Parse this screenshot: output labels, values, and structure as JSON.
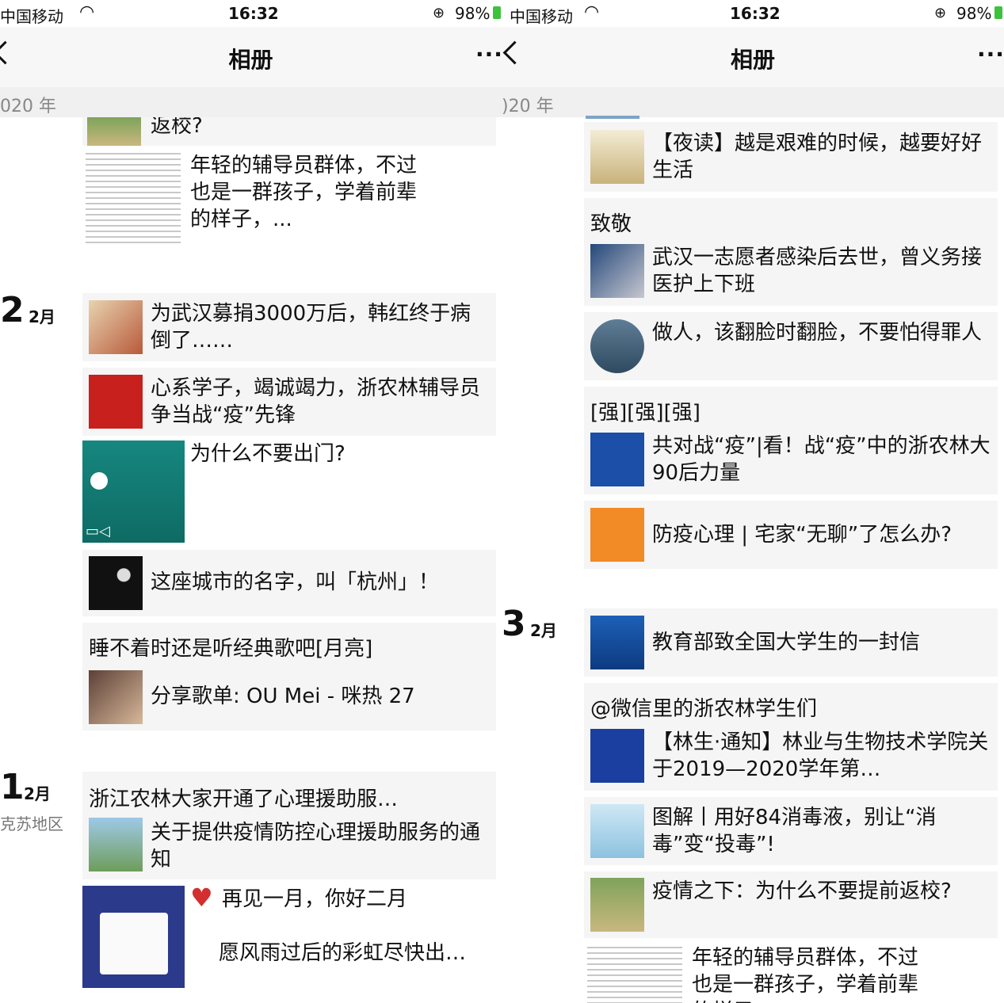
{
  "status": {
    "carrier": "中国移动",
    "time": "16:32",
    "battery": "98%"
  },
  "nav": {
    "title": "相册",
    "more": "···"
  },
  "left": {
    "year_partial": "020 年",
    "group1": {
      "title_tail": "返校?",
      "excerpt": "年轻的辅导员群体，不过也是一群孩子，学着前辈的样子，..."
    },
    "group2": {
      "day": "2",
      "month": "2月",
      "items": [
        "为武汉募捐3000万后，韩红终于病倒了……",
        "心系学子，竭诚竭力，浙农林辅导员争当战“疫”先锋",
        "为什么不要出门?",
        "这座城市的名字，叫「杭州」！"
      ],
      "music_header": "睡不着时还是听经典歌吧[月亮]",
      "music_item": "分享歌单: OU Mei - 咪热 27"
    },
    "group3": {
      "day": "1",
      "month": "2月",
      "location": "克苏地区",
      "header": "浙江农林大家开通了心理援助服…",
      "item": "关于提供疫情防控心理援助服务的通知",
      "post_line1": "再见一月，你好二月",
      "post_line2": "愿风雨过后的彩虹尽快出…"
    }
  },
  "right": {
    "year_partial": ")20 年",
    "items": [
      {
        "title": "【夜读】越是艰难的时候，越要好好生活"
      },
      {
        "header": "致敬",
        "title": "武汉一志愿者感染后去世，曾义务接医护上下班"
      },
      {
        "title": "做人，该翻脸时翻脸，不要怕得罪人"
      },
      {
        "header": "[强][强][强]",
        "title": "共对战“疫”|看！战“疫”中的浙农林大90后力量"
      },
      {
        "title": "防疫心理 | 宅家“无聊”了怎么办?"
      }
    ],
    "group": {
      "day": "3",
      "month": "2月",
      "items": [
        {
          "title": "教育部致全国大学生的一封信"
        },
        {
          "header": "@微信里的浙农林学生们",
          "title": "【林生·通知】林业与生物技术学院关于2019—2020学年第…"
        },
        {
          "title": "图解丨用好84消毒液，别让“消毒”变“投毒”!"
        },
        {
          "title": "疫情之下：为什么不要提前返校?"
        }
      ],
      "excerpt": "年轻的辅导员群体，不过也是一群孩子，学着前辈的样子，..."
    }
  }
}
